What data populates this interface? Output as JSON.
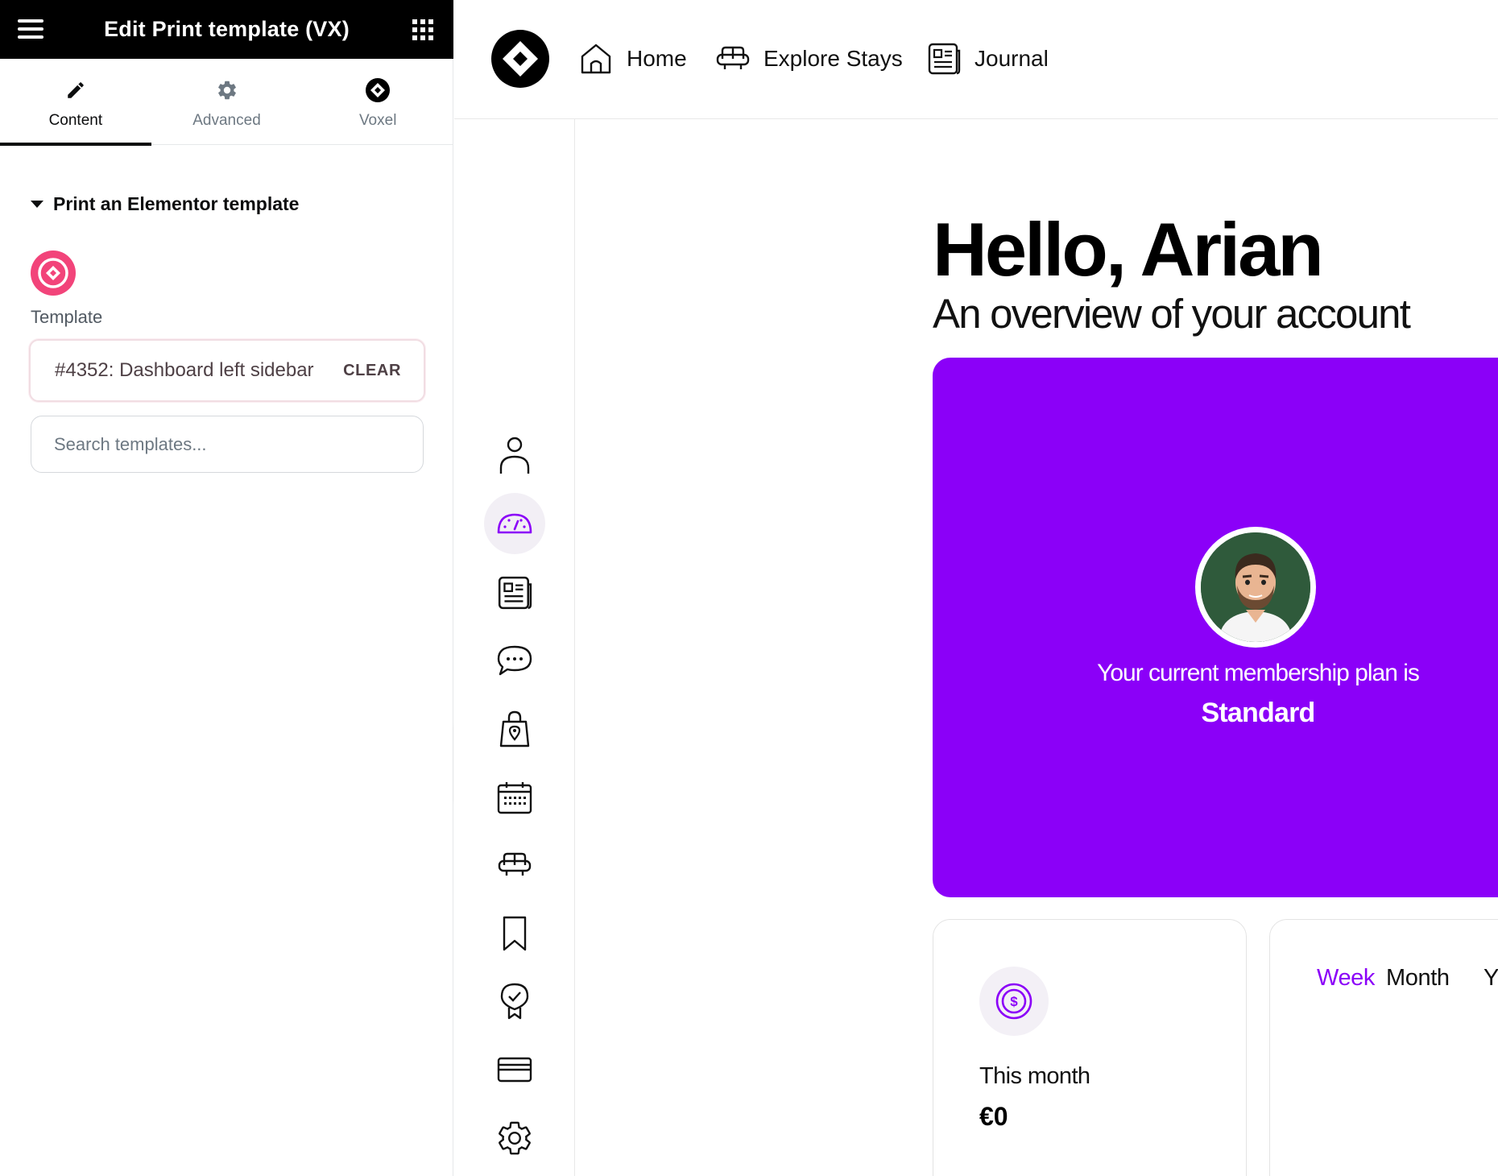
{
  "panel": {
    "title": "Edit Print template (VX)",
    "tabs": [
      {
        "label": "Content",
        "icon": "pencil-icon"
      },
      {
        "label": "Advanced",
        "icon": "gear-icon"
      },
      {
        "label": "Voxel",
        "icon": "voxel-logo-icon"
      }
    ],
    "active_tab": "Content",
    "section_title": "Print an Elementor template",
    "template_label": "Template",
    "template_value": "#4352: Dashboard left sidebar",
    "clear_label": "CLEAR",
    "search_placeholder": "Search templates..."
  },
  "preview": {
    "nav": [
      {
        "label": "Home",
        "icon": "home-icon"
      },
      {
        "label": "Explore Stays",
        "icon": "sofa-icon"
      },
      {
        "label": "Journal",
        "icon": "newspaper-icon"
      }
    ],
    "sidebar_icons": [
      "user-icon",
      "dashboard-gauge-icon",
      "newspaper-icon",
      "chat-bubble-icon",
      "shopping-bag-icon",
      "calendar-icon",
      "sofa-icon",
      "bookmark-icon",
      "award-badge-icon",
      "credit-card-icon",
      "settings-gear-icon"
    ],
    "active_sidebar": "dashboard-gauge-icon",
    "greeting": "Hello, Arian",
    "subtitle": "An overview of your account",
    "membership_text": "Your current membership plan is",
    "membership_plan": "Standard",
    "stat_label": "This month",
    "stat_value": "€0",
    "period_tabs": [
      "Week",
      "Month",
      "Y"
    ],
    "active_period": "Week"
  },
  "colors": {
    "accent_purple": "#8b00f8",
    "elementor_pink": "#f2447a",
    "header_black": "#000000"
  }
}
